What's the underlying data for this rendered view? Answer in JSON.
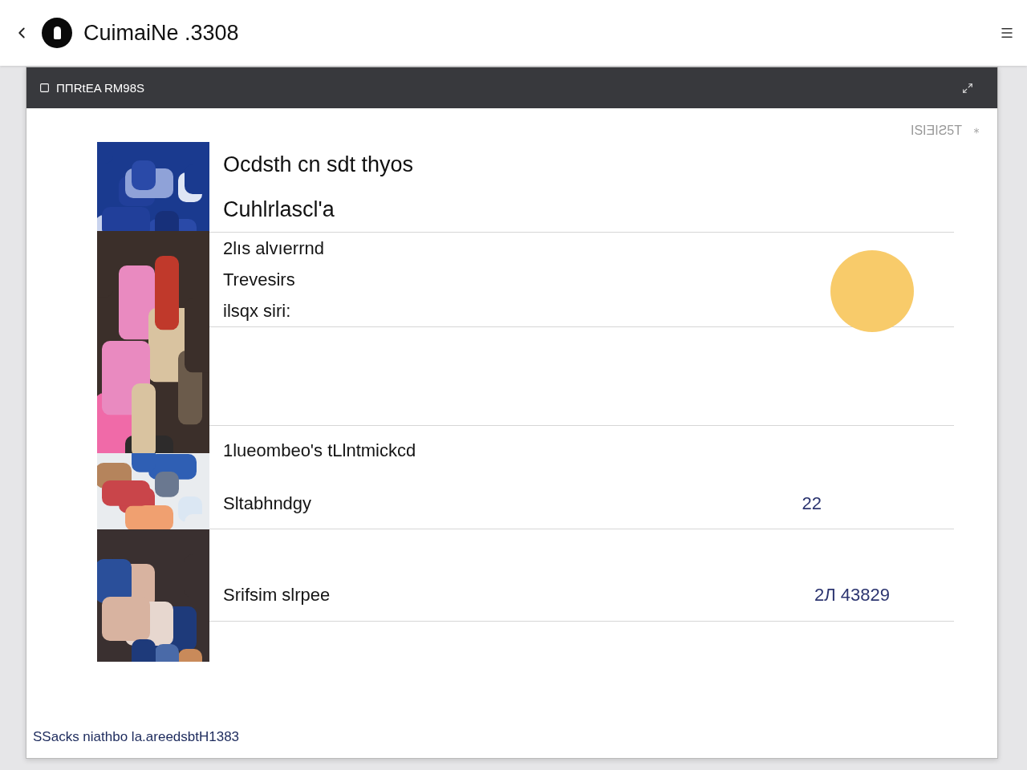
{
  "app_bar": {
    "title": "CuimaiNe .3308"
  },
  "panel": {
    "title": "ΠΠRtEA RM98S",
    "corner_text": "ISIƎIƧ5T"
  },
  "rows": [
    {
      "kind": "heading",
      "lines": [
        "Ocdsth cn sdt thyos",
        "Cuhlrlascl'a"
      ]
    },
    {
      "kind": "marker",
      "lines": [
        "2lıs alvıerrnd",
        "Trevesirs",
        "ilsqx siri:"
      ]
    },
    {
      "kind": "split",
      "top": "1lueombeo's tLlntmickcd",
      "bottom": "Sltabhndgy",
      "value": "22"
    },
    {
      "kind": "value",
      "lines": [
        "Srifsim slrpee"
      ],
      "value": "2Л 43829"
    }
  ],
  "footer": "SSacks niathbo la.areedsbtH1383"
}
